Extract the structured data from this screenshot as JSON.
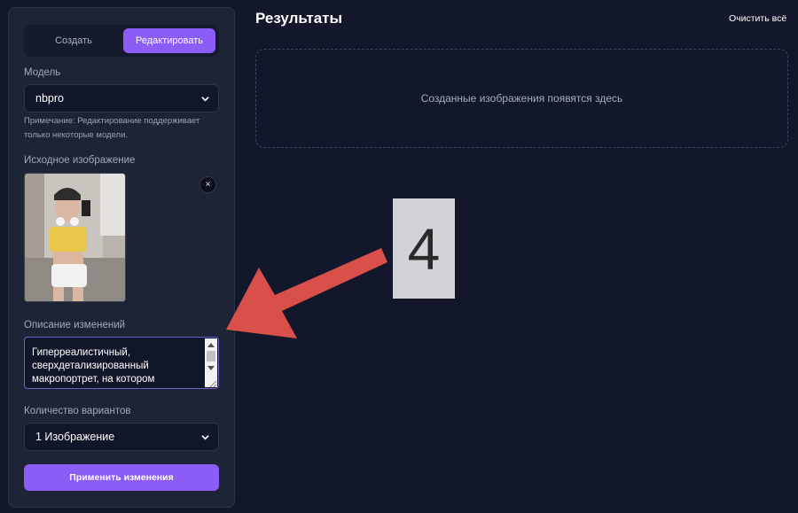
{
  "sidebar": {
    "mode_tabs": [
      {
        "label": "Создать",
        "active": false
      },
      {
        "label": "Редактировать",
        "active": true
      }
    ],
    "model": {
      "label": "Модель",
      "selected": "nbpro",
      "note": "Примечание: Редактирование поддерживает только некоторые модели."
    },
    "source_image": {
      "label": "Исходное изображение",
      "remove_symbol": "×"
    },
    "description": {
      "label": "Описание изменений",
      "value": "Гиперреалистичный,\nсверхдетализированный\nмакропортрет, на котором"
    },
    "variants": {
      "label": "Количество вариантов",
      "selected": "1 Изображение"
    },
    "apply_label": "Применить изменения"
  },
  "results": {
    "title": "Результаты",
    "clear_label": "Очистить всё",
    "placeholder": "Созданные изображения появятся здесь"
  },
  "annotation": {
    "number": "4"
  },
  "colors": {
    "accent": "#8b5cf6",
    "background": "#12172b",
    "panel": "#1d2436",
    "arrow": "#d9504a"
  }
}
